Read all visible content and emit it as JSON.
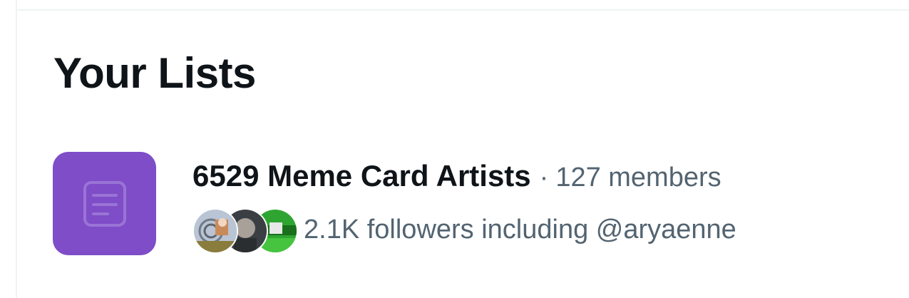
{
  "page": {
    "heading": "Your Lists"
  },
  "list": {
    "name": "6529 Meme Card Artists",
    "separator": "·",
    "members": "127 members",
    "followers_text": "2.1K followers including @aryaenne",
    "thumb_color": "#7e4dc7",
    "thumb_icon": "list-icon",
    "avatars": [
      "follower-avatar-1",
      "follower-avatar-2",
      "follower-avatar-3"
    ]
  },
  "colors": {
    "text_primary": "#0f1419",
    "text_secondary": "#536471",
    "divider": "#eff3f4"
  }
}
